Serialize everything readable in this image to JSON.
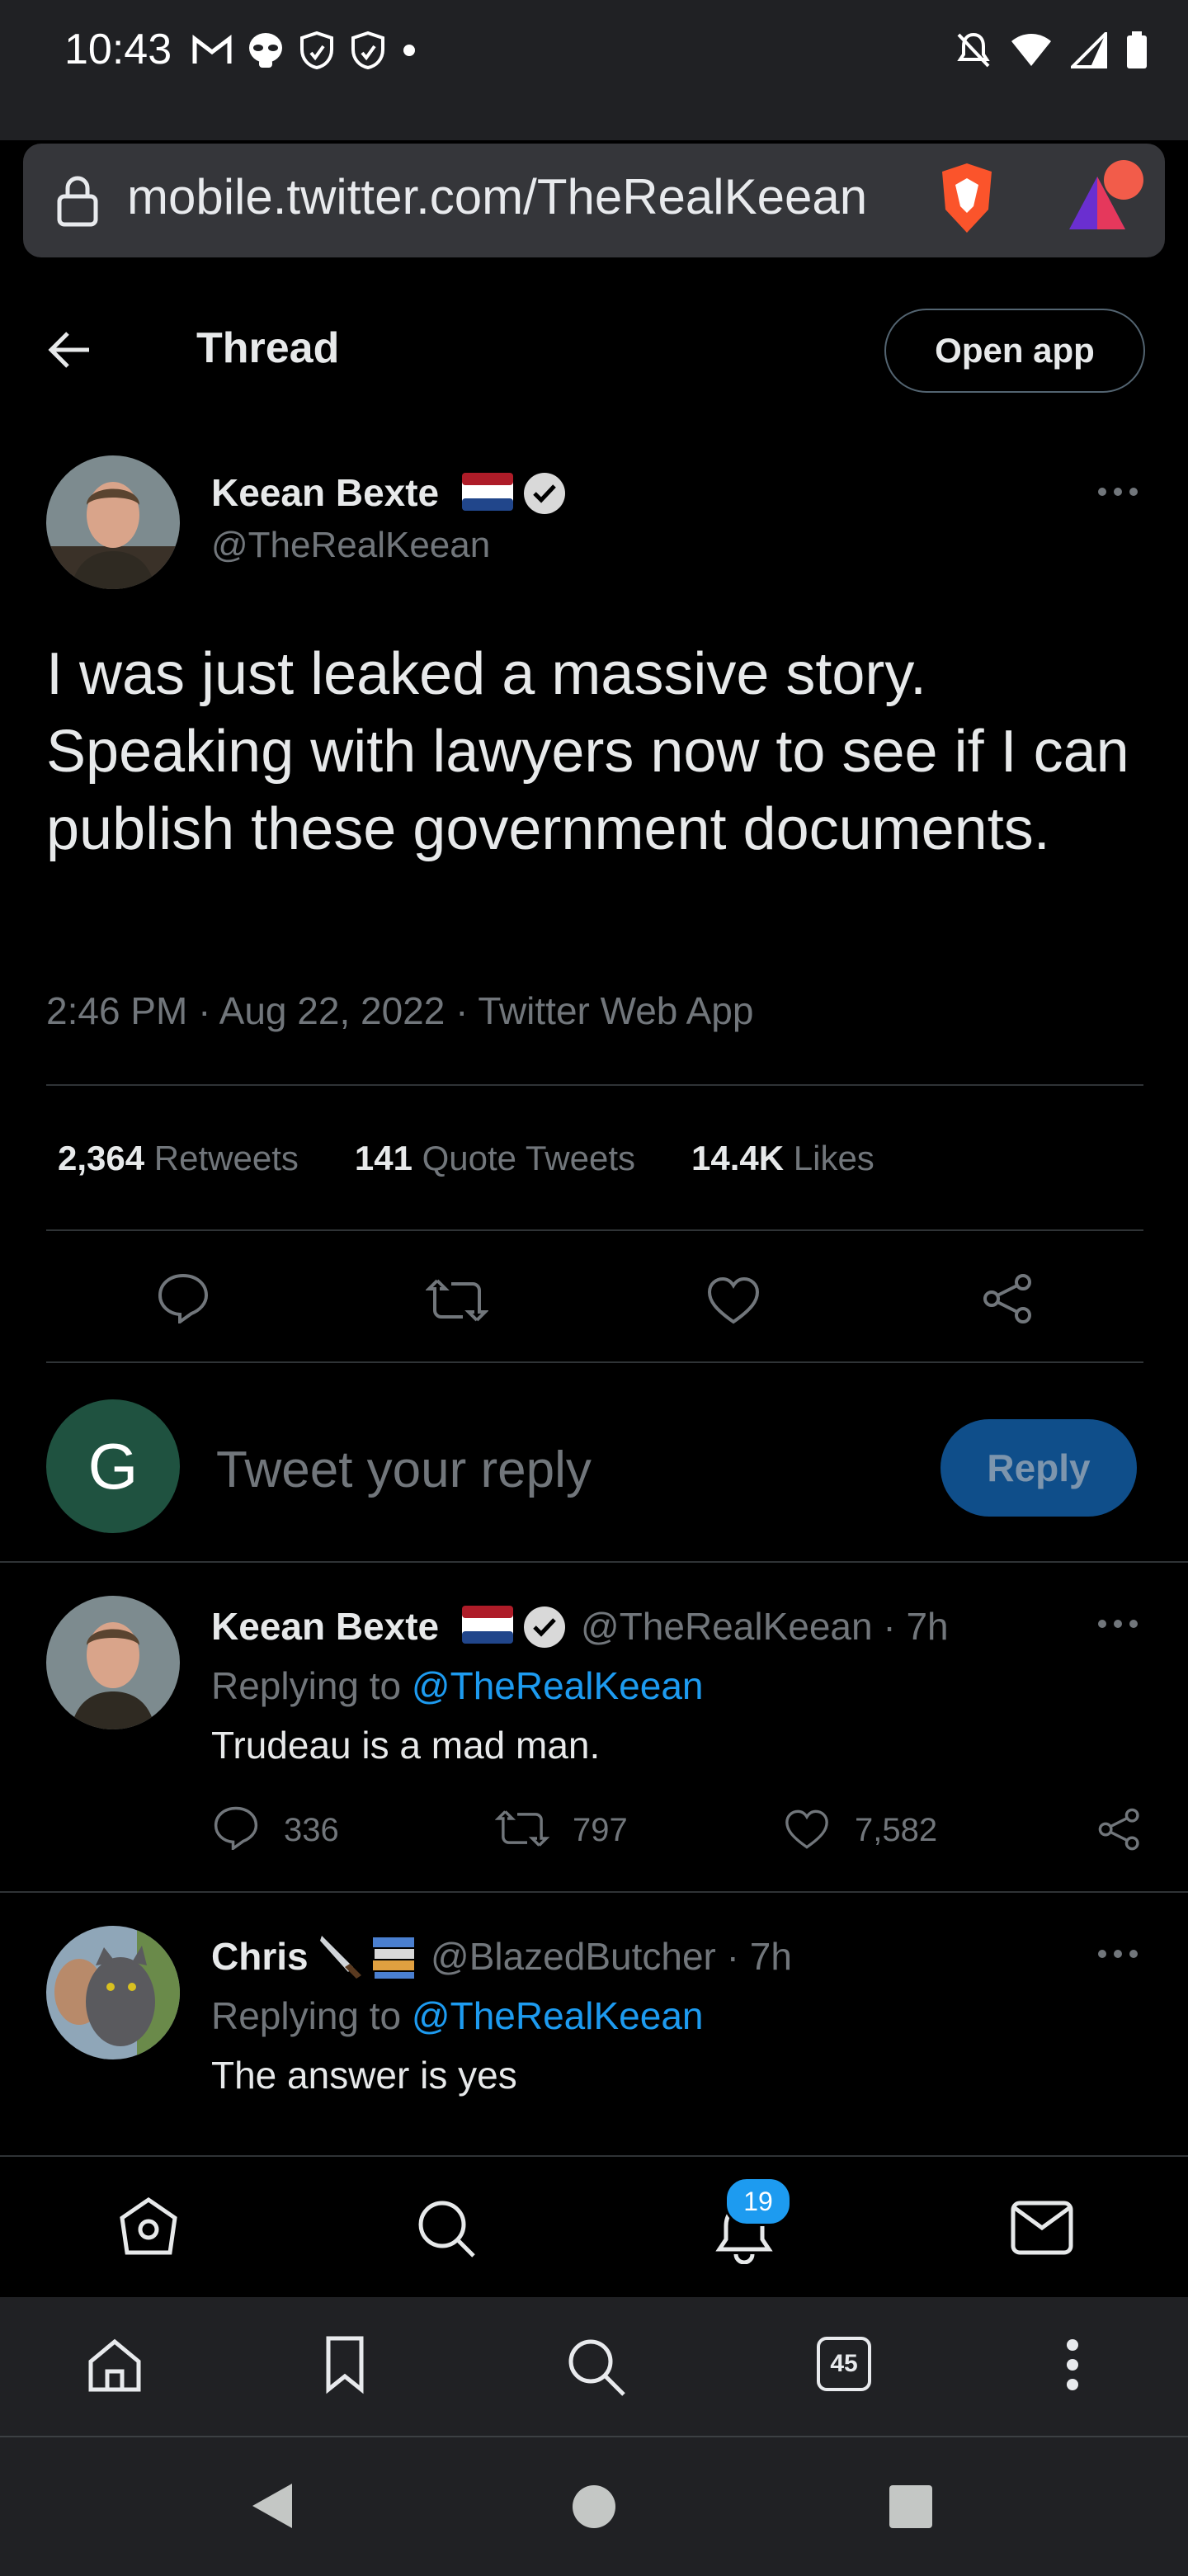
{
  "status_bar": {
    "time": "10:43"
  },
  "browser": {
    "url": "mobile.twitter.com/TheRealKeean",
    "tab_count": "45"
  },
  "header": {
    "title": "Thread",
    "open_app_label": "Open app"
  },
  "main_tweet": {
    "author_name": "Keean Bexte",
    "author_handle": "@TheRealKeean",
    "text": "I was just leaked a massive story. Speaking with lawyers now to see if I can publish these government documents.",
    "meta": "2:46 PM · Aug 22, 2022 · Twitter Web App",
    "stats": [
      {
        "value": "2,364",
        "label": "Retweets"
      },
      {
        "value": "141",
        "label": "Quote Tweets"
      },
      {
        "value": "14.4K",
        "label": "Likes"
      }
    ]
  },
  "reply_composer": {
    "avatar_letter": "G",
    "placeholder": "Tweet your reply",
    "button_label": "Reply"
  },
  "replies": [
    {
      "author_name": "Keean Bexte",
      "handle_time": "@TheRealKeean · 7h",
      "replying_prefix": "Replying to",
      "replying_to": "@TheRealKeean",
      "text": "Trudeau is a mad man.",
      "reply_count": "336",
      "retweet_count": "797",
      "like_count": "7,582"
    },
    {
      "author_name": "Chris",
      "handle_time": "@BlazedButcher · 7h",
      "replying_prefix": "Replying to",
      "replying_to": "@TheRealKeean",
      "text": "The answer is yes"
    }
  ],
  "bottom_nav": {
    "notification_badge": "19"
  },
  "colors": {
    "accent": "#1d9bf0",
    "background": "#000000",
    "muted": "#71767b"
  }
}
